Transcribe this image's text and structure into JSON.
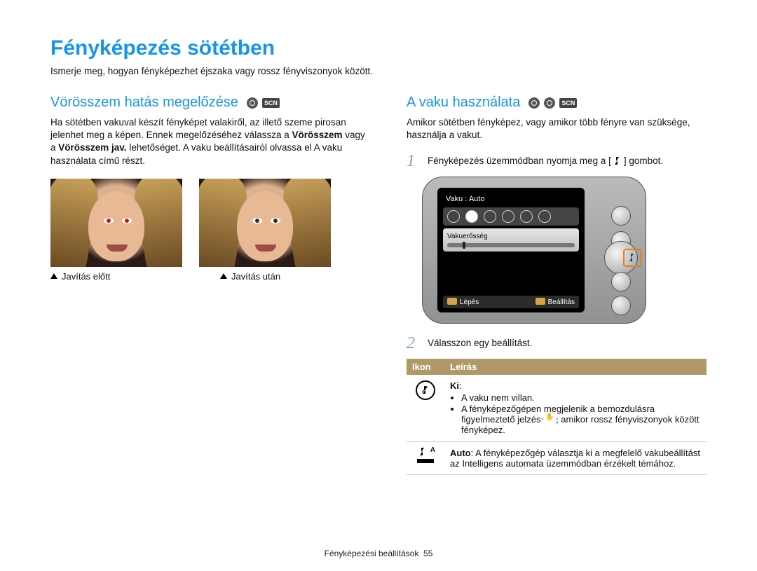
{
  "title": "Fényképezés sötétben",
  "intro": "Ismerje meg, hogyan fényképezhet éjszaka vagy rossz fényviszonyok között.",
  "left": {
    "heading": "Vörösszem hatás megelőzése",
    "para": "Ha sötétben vakuval készít fényképet valakiről, az illető szeme pirosan jelenhet meg a képen. Ennek megelőzéséhez válassza a Vörösszem vagy a Vörösszem jav. lehetőséget. A vaku beállításairól olvassa el A vaku használata című részt.",
    "bold_a": "Vörösszem",
    "bold_b": "Vörösszem jav.",
    "caption_before": "Javítás előtt",
    "caption_after": "Javítás után"
  },
  "right": {
    "heading": "A vaku használata",
    "para": "Amikor sötétben fényképez, vagy amikor több fényre van szüksége, használja a vakut.",
    "step1_pre": "Fényképezés üzemmódban nyomja meg a [",
    "step1_post": "] gombot.",
    "step2": "Válasszon egy beállítást.",
    "camera": {
      "top": "Vaku : Auto",
      "panel_title": "Vakuerősség",
      "hint_left": "Lépés",
      "hint_right": "Beállítás"
    },
    "table": {
      "head_icon": "Ikon",
      "head_desc": "Leírás",
      "rows": [
        {
          "icon": "flash-off",
          "title": "Ki",
          "bullets": [
            "A vaku nem villan.",
            "A fényképezőgépen megjelenik a bemozdulásra figyelmeztető jelzés ‹✋›, amikor rossz fényviszonyok között fényképez."
          ]
        },
        {
          "icon": "flash-auto",
          "title": "Auto",
          "body": ": A fényképezőgép választja ki a megfelelő vakubeállítást az Intelligens automata üzemmódban érzékelt témához."
        }
      ]
    }
  },
  "footer_label": "Fényképezési beállítások",
  "page_num": "55"
}
